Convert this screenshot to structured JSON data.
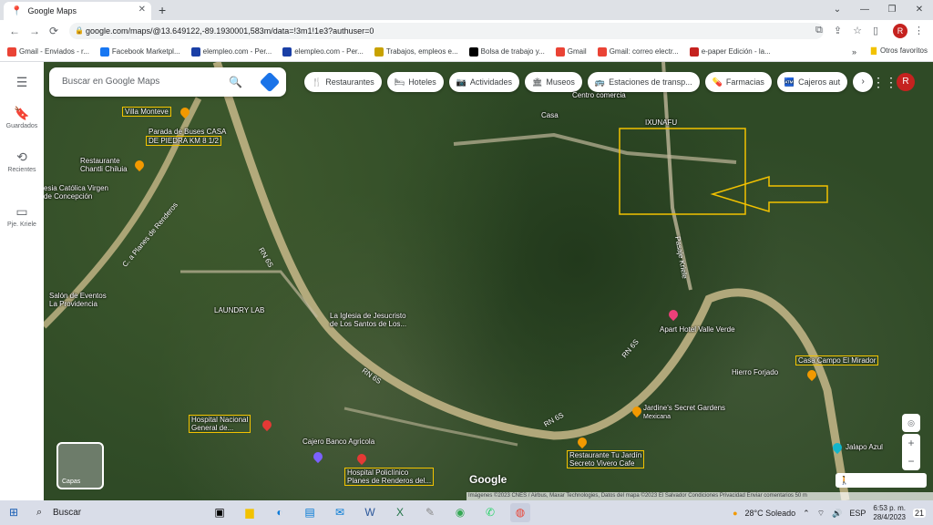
{
  "browser": {
    "tab_title": "Google Maps",
    "tab_close": "✕",
    "new_tab": "+",
    "url": "google.com/maps/@13.649122,-89.1930001,583m/data=!3m1!1e3?authuser=0",
    "profile_initial": "R",
    "window_controls": [
      "⌄",
      "—",
      "❐",
      "✕"
    ]
  },
  "bookmarks": [
    {
      "label": "Gmail - Enviados - r...",
      "color": "#ea4335"
    },
    {
      "label": "Facebook Marketpl...",
      "color": "#1877f2"
    },
    {
      "label": "elempleo.com - Per...",
      "color": "#1a3fa6"
    },
    {
      "label": "elempleo.com - Per...",
      "color": "#1a3fa6"
    },
    {
      "label": "Trabajos, empleos e...",
      "color": "#c8a200"
    },
    {
      "label": "Bolsa de trabajo y...",
      "color": "#000000"
    },
    {
      "label": "Gmail",
      "color": "#ea4335"
    },
    {
      "label": "Gmail: correo electr...",
      "color": "#ea4335"
    },
    {
      "label": "e-paper Edición - la...",
      "color": "#c5221f"
    }
  ],
  "bookmarks_more": "»",
  "bookmarks_other": "Otros favoritos",
  "rail": {
    "menu": "☰",
    "saved": "Guardados",
    "recent": "Recientes",
    "place": "Pje. Kriele"
  },
  "search": {
    "placeholder": "Buscar en Google Maps"
  },
  "chips": [
    {
      "icon": "🍴",
      "label": "Restaurantes"
    },
    {
      "icon": "🛏",
      "label": "Hoteles"
    },
    {
      "icon": "📷",
      "label": "Actividades"
    },
    {
      "icon": "🏛",
      "label": "Museos"
    },
    {
      "icon": "🚌",
      "label": "Estaciones de transp..."
    },
    {
      "icon": "💊",
      "label": "Farmacias"
    },
    {
      "icon": "🏧",
      "label": "Cajeros aut"
    }
  ],
  "chip_next": "›",
  "map_avatar": "R",
  "map_labels": {
    "villa_monteve": "Villa Monteve",
    "parada": "Parada de Buses CASA",
    "piedra": "DE PIEDRA KM 8 1/2",
    "restaurante_chantli": "Restaurante\nChantli Chiluia",
    "iglesia_catolica": "esia Católica Virgen\nde Concepción",
    "carretera": "C. a Planes de Renderos",
    "rn6s_a": "RN 6S",
    "rn6s_b": "RN 6S",
    "rn6s_c": "RN 6S",
    "rn6s_d": "RN 6S",
    "salon": "Salón de Eventos\nLa Providencia",
    "laundry": "LAUNDRY LAB",
    "iglesia_jesucristo": "La Iglesia de Jesucristo\nde Los Santos de Los...",
    "centro": "Centro comercia",
    "casa": "Casa",
    "kunafu": "IXUNAFU",
    "pasaje_kriele": "Pasaje Kriele",
    "apart_hotel": "Apart Hotel Valle Verde",
    "casa_campo": "Casa Campo El Mirador",
    "hierro": "Hierro Forjado",
    "jardines": "Jardine's Secret Gardens",
    "mexicana": "Mexicana",
    "hospital_nacional": "Hospital Nacional\nGeneral de...",
    "cajero": "Cajero Banco Agricola",
    "hospital_policlinico": "Hospital Policlínico\nPlanes de Renderos del...",
    "restaurante_jardin": "Restaurante Tu Jardín\nSecreto Vivero Cafe",
    "jalapo": "Jalapo Azul"
  },
  "layers_label": "Capas",
  "google_logo": "Google",
  "attribution": "Imágenes ©2023 CNES / Airbus, Maxar Technologies, Datos del mapa ©2023   El Salvador   Condiciones   Privacidad   Enviar comentarios   50 m",
  "taskbar": {
    "search": "Buscar",
    "weather": "28°C Soleado",
    "lang": "ESP",
    "time": "6:53 p. m.",
    "date": "28/4/2023",
    "notif": "21"
  },
  "colors": {
    "highlight": "#f2c200",
    "tab_bg": "#dee1e6",
    "taskbar_bg": "#d9dde8",
    "map_forest": "#2f4a26"
  }
}
